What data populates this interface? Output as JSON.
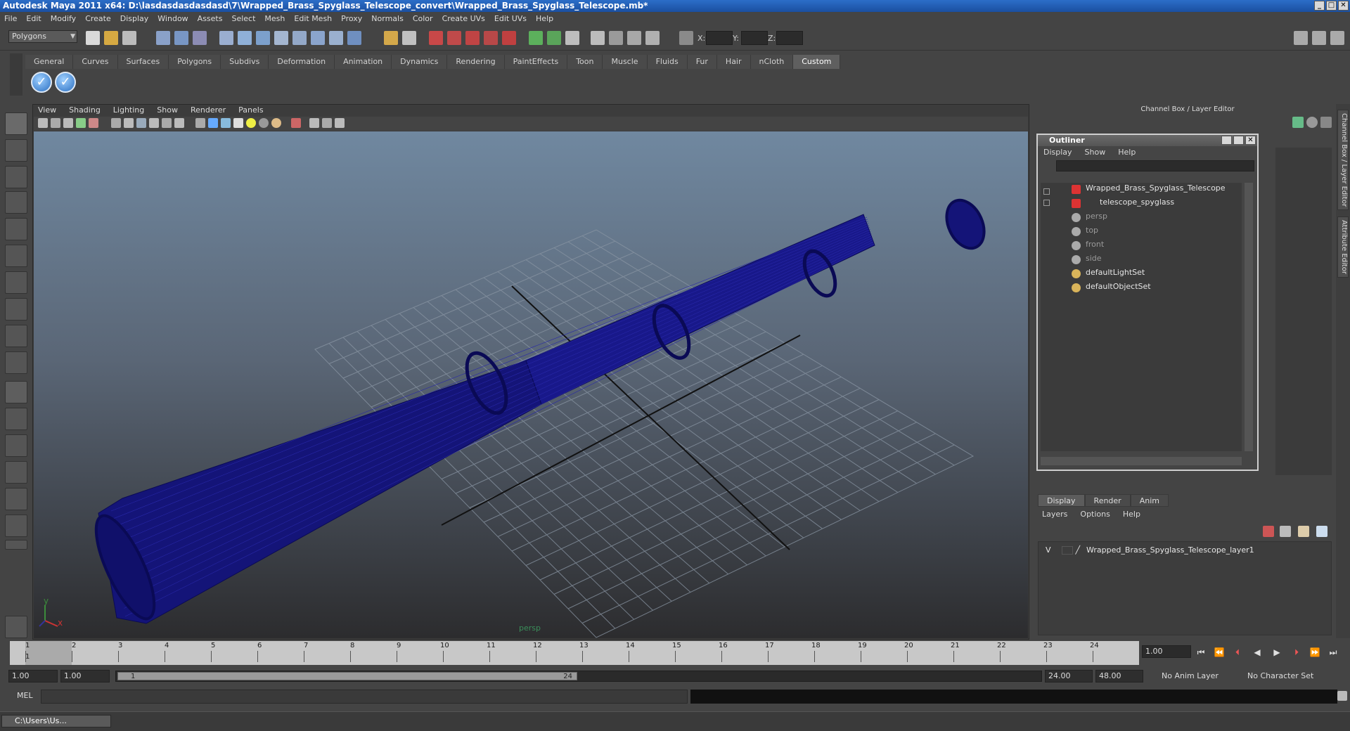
{
  "window": {
    "title": "Autodesk Maya 2011 x64: D:\\lasdasdasdasdasd\\7\\Wrapped_Brass_Spyglass_Telescope_convert\\Wrapped_Brass_Spyglass_Telescope.mb*",
    "controls": [
      "_",
      "□",
      "✕"
    ]
  },
  "menubar": [
    "File",
    "Edit",
    "Modify",
    "Create",
    "Display",
    "Window",
    "Assets",
    "Select",
    "Mesh",
    "Edit Mesh",
    "Proxy",
    "Normals",
    "Color",
    "Create UVs",
    "Edit UVs",
    "Help"
  ],
  "statusline": {
    "mode": "Polygons",
    "coords": {
      "x_label": "X:",
      "y_label": "Y:",
      "z_label": "Z:"
    }
  },
  "shelf": {
    "tabs": [
      "General",
      "Curves",
      "Surfaces",
      "Polygons",
      "Subdivs",
      "Deformation",
      "Animation",
      "Dynamics",
      "Rendering",
      "PaintEffects",
      "Toon",
      "Muscle",
      "Fluids",
      "Fur",
      "Hair",
      "nCloth",
      "Custom"
    ],
    "active_tab": "Custom"
  },
  "viewport": {
    "menu": [
      "View",
      "Shading",
      "Lighting",
      "Show",
      "Renderer",
      "Panels"
    ],
    "camera_label": "persp",
    "axis_x": "x",
    "axis_y": "y"
  },
  "channel_box": {
    "title": "Channel Box / Layer Editor",
    "side_tabs": [
      "Channel Box / Layer Editor",
      "Attribute Editor"
    ]
  },
  "outliner": {
    "title": "Outliner",
    "menu": [
      "Display",
      "Show",
      "Help"
    ],
    "items": [
      {
        "label": "Wrapped_Brass_Spyglass_Telescope",
        "dim": false
      },
      {
        "label": "telescope_spyglass",
        "dim": false
      },
      {
        "label": "persp",
        "dim": true
      },
      {
        "label": "top",
        "dim": true
      },
      {
        "label": "front",
        "dim": true
      },
      {
        "label": "side",
        "dim": true
      },
      {
        "label": "defaultLightSet",
        "dim": false
      },
      {
        "label": "defaultObjectSet",
        "dim": false
      }
    ]
  },
  "layer_editor": {
    "tabs": [
      "Display",
      "Render",
      "Anim"
    ],
    "active_tab": "Display",
    "menu": [
      "Layers",
      "Options",
      "Help"
    ],
    "layer_visible": "V",
    "layer_name": "Wrapped_Brass_Spyglass_Telescope_layer1"
  },
  "timeline": {
    "frames": [
      "1",
      "2",
      "3",
      "4",
      "5",
      "6",
      "7",
      "8",
      "9",
      "10",
      "11",
      "12",
      "13",
      "14",
      "15",
      "16",
      "17",
      "18",
      "19",
      "20",
      "21",
      "22",
      "23",
      "24"
    ],
    "current_frame_marker": "1",
    "current_frame": "1.00"
  },
  "range": {
    "start": "1.00",
    "playback_start": "1.00",
    "handle_start": "1",
    "handle_end": "24",
    "playback_end": "24.00",
    "end": "48.00",
    "anim_layer": "No Anim Layer",
    "character_set": "No Character Set"
  },
  "command_line": {
    "label": "MEL"
  },
  "taskbar": {
    "item": "C:\\Users\\Us..."
  },
  "colors": {
    "wireframe": "#14147a",
    "accent": "#2c6ec8"
  }
}
